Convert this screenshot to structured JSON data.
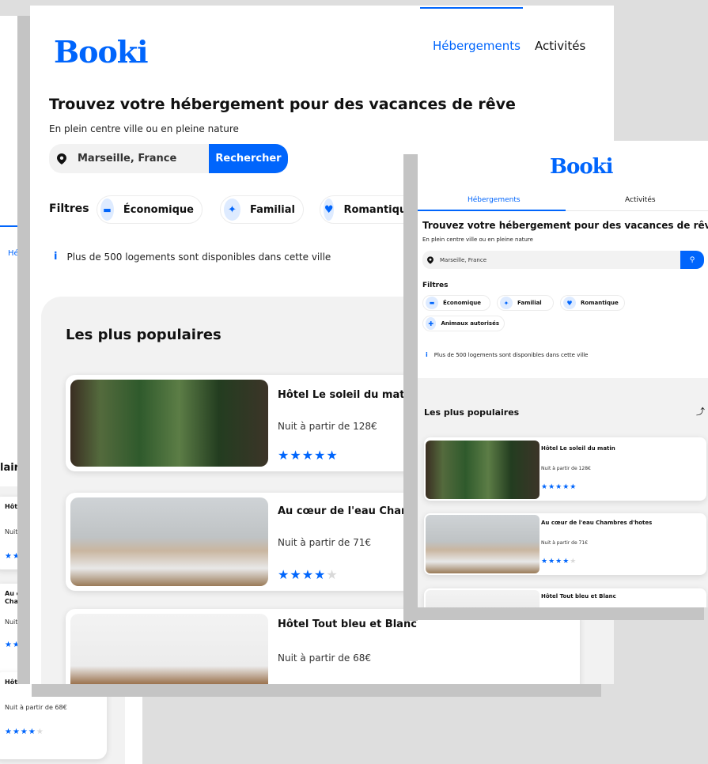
{
  "brand": {
    "logo": "Booki",
    "accent": "#0065fc"
  },
  "nav": {
    "hebergements": "Hébergements",
    "activites": "Activités",
    "partial": "Hébe"
  },
  "hero": {
    "title": "Trouvez votre hébergement pour des vacances de rêve",
    "subtitle": "En plein centre ville ou en pleine nature"
  },
  "search": {
    "value": "Marseille, France",
    "button": "Rechercher"
  },
  "filters": {
    "label": "Filtres",
    "items": [
      "Économique",
      "Familial",
      "Romantique",
      "Animaux autorisés"
    ]
  },
  "info": {
    "icon": "i",
    "text": "Plus de 500 logements sont disponibles dans cette ville"
  },
  "popular": {
    "title": "Les plus populaires",
    "partial_title": "laires",
    "items": [
      {
        "name": "Hôtel Le soleil du matin",
        "price": "Nuit à partir de 128€",
        "rating": 5,
        "stars_on": "★★★★★",
        "stars_off": ""
      },
      {
        "name": "Au cœur de l'eau Chambres d'hotes",
        "price": "Nuit à partir de 71€",
        "rating": 4,
        "stars_on": "★★★★",
        "stars_off": "★"
      },
      {
        "name": "Hôtel Tout bleu et Blanc",
        "price": "Nuit à partir de 68€",
        "rating": 4,
        "stars_on": "★★★★",
        "stars_off": "★"
      }
    ]
  },
  "partial": {
    "hotel1": "Hôtel L",
    "price1": "Nuit à p",
    "au_coeur": "Au cœu",
    "chamb": "Chamb",
    "price2": "Nuit à p",
    "hotel3": "Hôtel To",
    "name2_main": "Au cœur de l'eau Chambres d"
  }
}
